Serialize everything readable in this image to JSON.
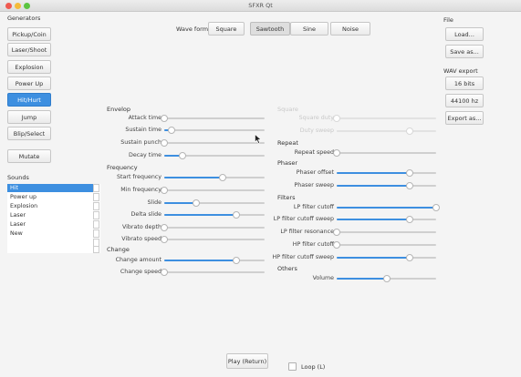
{
  "window": {
    "title": "SFXR Qt"
  },
  "generators": {
    "heading": "Generators",
    "buttons": [
      "Pickup/Coin",
      "Laser/Shoot",
      "Explosion",
      "Power Up",
      "Hit/Hurt",
      "Jump",
      "Blip/Select"
    ],
    "active_index": 4,
    "mutate": "Mutate"
  },
  "sounds": {
    "heading": "Sounds",
    "items": [
      "Hit",
      "Power up",
      "Explosion",
      "Laser",
      "Laser",
      "New"
    ],
    "selected_index": 0
  },
  "waveform": {
    "label": "Wave form",
    "options": [
      "Square",
      "Sawtooth",
      "Sine",
      "Noise"
    ],
    "selected_index": 1
  },
  "sections": {
    "envelope": "Envelop",
    "frequency": "Frequency",
    "change": "Change",
    "square": "Square",
    "repeat": "Repeat",
    "phaser": "Phaser",
    "filters": "Filters",
    "others": "Others"
  },
  "params": {
    "attack_time": {
      "label": "Attack time",
      "value": 0.0
    },
    "sustain_time": {
      "label": "Sustain time",
      "value": 0.07
    },
    "sustain_punch": {
      "label": "Sustain punch",
      "value": 0.0
    },
    "decay_time": {
      "label": "Decay time",
      "value": 0.18
    },
    "start_frequency": {
      "label": "Start frequency",
      "value": 0.58
    },
    "min_frequency": {
      "label": "Min frequency",
      "value": 0.0
    },
    "slide": {
      "label": "Slide",
      "value": 0.32
    },
    "delta_slide": {
      "label": "Delta slide",
      "value": 0.72
    },
    "vibrato_depth": {
      "label": "Vibrato depth",
      "value": 0.0
    },
    "vibrato_speed": {
      "label": "Vibrato speed",
      "value": 0.0
    },
    "change_amount": {
      "label": "Change amount",
      "value": 0.72
    },
    "change_speed": {
      "label": "Change speed",
      "value": 0.0
    },
    "square_duty": {
      "label": "Square duty",
      "value": 0.0,
      "disabled": true
    },
    "duty_sweep": {
      "label": "Duty sweep",
      "value": 0.73,
      "disabled": true
    },
    "repeat_speed": {
      "label": "Repeat speed",
      "value": 0.0
    },
    "phaser_offset": {
      "label": "Phaser offset",
      "value": 0.73
    },
    "phaser_sweep": {
      "label": "Phaser sweep",
      "value": 0.73
    },
    "lp_cutoff": {
      "label": "LP filter cutoff",
      "value": 1.0
    },
    "lp_cutoff_sweep": {
      "label": "LP filter cutoff sweep",
      "value": 0.73
    },
    "lp_resonance": {
      "label": "LP filter resonance",
      "value": 0.0
    },
    "hp_cutoff": {
      "label": "HP filter cutoff",
      "value": 0.0
    },
    "hp_cutoff_sweep": {
      "label": "HP filter cutoff sweep",
      "value": 0.73
    },
    "volume": {
      "label": "Volume",
      "value": 0.5
    }
  },
  "file": {
    "heading": "File",
    "load": "Load...",
    "save": "Save as..."
  },
  "wav_export": {
    "heading": "WAV export",
    "bits": "16 bits",
    "rate": "44100 hz",
    "export": "Export as..."
  },
  "playback": {
    "play": "Play (Return)",
    "loop": "Loop (L)",
    "loop_checked": false
  },
  "colors": {
    "accent": "#3d8fe0"
  }
}
